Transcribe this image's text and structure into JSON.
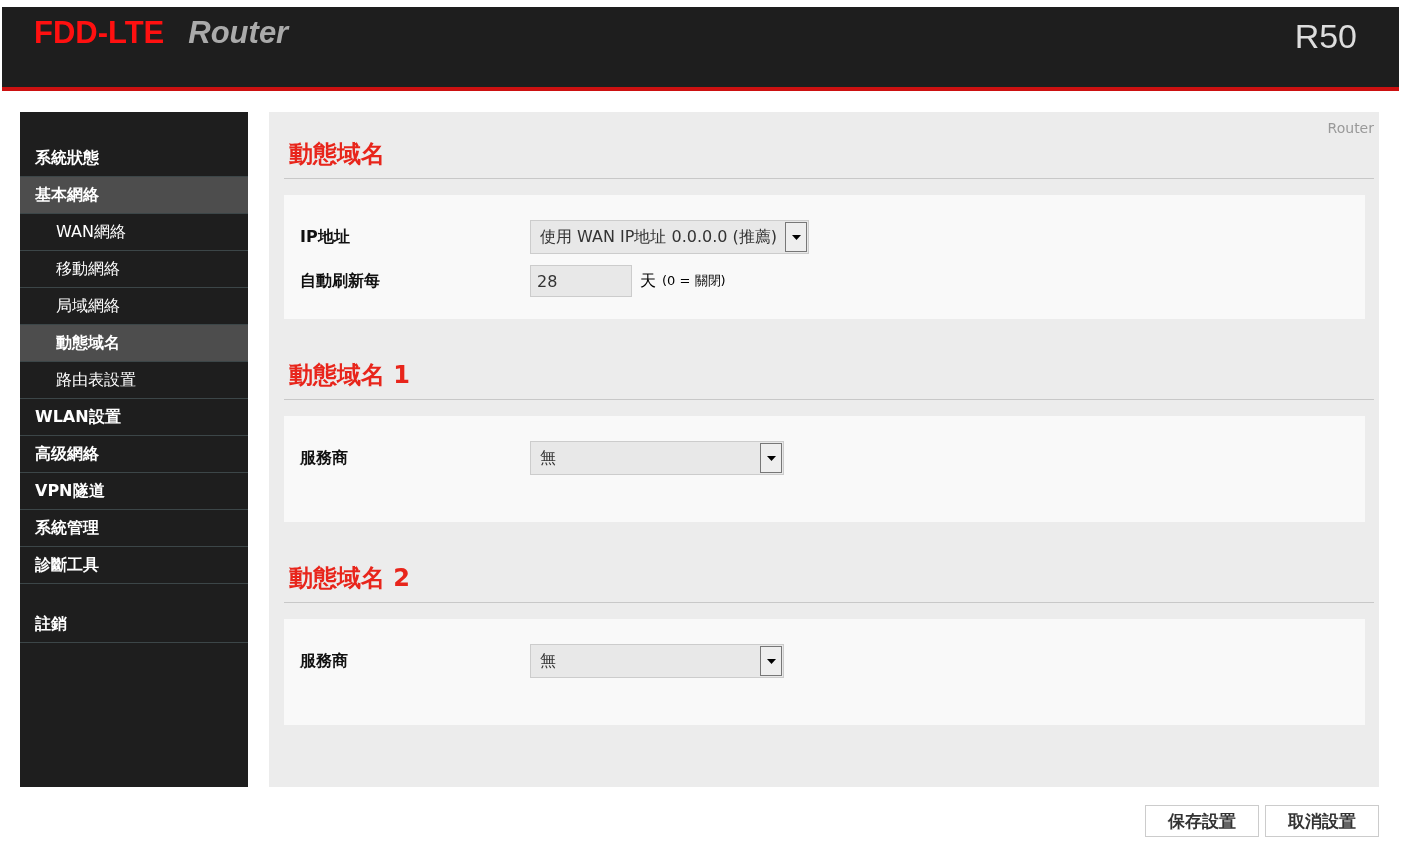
{
  "header": {
    "brand": "FDD-LTE",
    "product": "Router",
    "model": "R50"
  },
  "sidebar": {
    "items": [
      {
        "label": "系統狀態",
        "selected": false
      },
      {
        "label": "基本網絡",
        "selected": true,
        "children": [
          {
            "label": "WAN網絡",
            "selected": false
          },
          {
            "label": "移動網絡",
            "selected": false
          },
          {
            "label": "局域網絡",
            "selected": false
          },
          {
            "label": "動態域名",
            "selected": true
          },
          {
            "label": "路由表設置",
            "selected": false
          }
        ]
      },
      {
        "label": "WLAN設置",
        "selected": false
      },
      {
        "label": "高级網絡",
        "selected": false
      },
      {
        "label": "VPN隧道",
        "selected": false
      },
      {
        "label": "系統管理",
        "selected": false
      },
      {
        "label": "診斷工具",
        "selected": false
      }
    ],
    "footer_items": [
      {
        "label": "註銷",
        "selected": false
      }
    ]
  },
  "breadcrumb": "Router",
  "sections": [
    {
      "title": "動態域名",
      "fields": [
        {
          "kind": "select",
          "label": "IP地址",
          "value": "使用 WAN IP地址 0.0.0.0 (推薦)"
        },
        {
          "kind": "number",
          "label": "自動刷新每",
          "value": "28",
          "unit": "天",
          "hint": "(0 = 關閉)"
        }
      ]
    },
    {
      "title": "動態域名 1",
      "fields": [
        {
          "kind": "select",
          "label": "服務商",
          "value": "無"
        }
      ]
    },
    {
      "title": "動態域名 2",
      "fields": [
        {
          "kind": "select",
          "label": "服務商",
          "value": "無"
        }
      ]
    }
  ],
  "buttons": [
    "保存設置",
    "取消設置"
  ]
}
